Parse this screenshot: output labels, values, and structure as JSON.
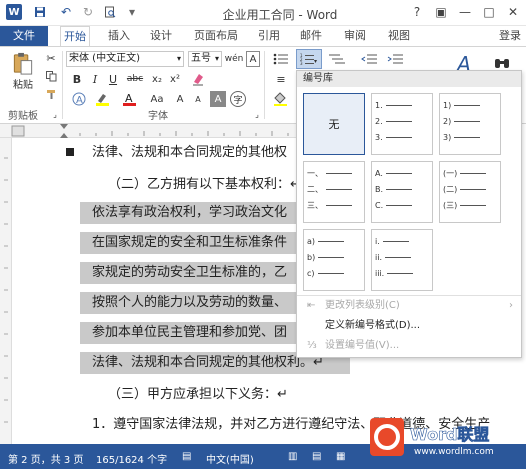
{
  "title_bar": {
    "title": "企业用工合同 - Word"
  },
  "tabs": [
    "文件",
    "开始",
    "插入",
    "设计",
    "页面布局",
    "引用",
    "邮件",
    "审阅",
    "视图"
  ],
  "signin_label": "登录",
  "ribbon": {
    "font_name": "宋体 (中文正文)",
    "font_size": "五号",
    "clipboard_label": "剪贴板",
    "font_group_label": "字体",
    "paste_label": "粘贴"
  },
  "document": {
    "lines": [
      "法律、法规和本合同规定的其他权",
      "（二）乙方拥有以下基本权利：↵",
      "依法享有政治权利，学习政治文化",
      "在国家规定的安全和卫生标准条件",
      "家规定的劳动安全卫生标准的，乙",
      "按照个人的能力以及劳动的数量、",
      "参加本单位民主管理和参加党、团",
      "法律、法规和本合同规定的其他权利。↵",
      "（三）甲方应承担以下义务：↵",
      "1．遵守国家法律法规，并对乙方进行遵纪守法、职业道德、安全生产"
    ]
  },
  "dropdown": {
    "header": "编号库",
    "tiles": [
      {
        "label": "无",
        "rows": []
      },
      {
        "rows": [
          "1.",
          "2.",
          "3."
        ]
      },
      {
        "rows": [
          "1)",
          "2)",
          "3)"
        ]
      },
      {
        "rows": [
          "一、",
          "二、",
          "三、"
        ]
      },
      {
        "rows": [
          "A.",
          "B.",
          "C."
        ]
      },
      {
        "rows": [
          "(一)",
          "(二)",
          "(三)"
        ]
      },
      {
        "rows": [
          "a)",
          "b)",
          "c)"
        ]
      },
      {
        "rows": [
          "i.",
          "ii.",
          "iii."
        ]
      }
    ],
    "menu": [
      {
        "label": "更改列表级别(C)",
        "enabled": false
      },
      {
        "label": "定义新编号格式(D)...",
        "enabled": true
      },
      {
        "label": "设置编号值(V)...",
        "enabled": false
      }
    ]
  },
  "status_bar": {
    "page": "第 2 页，共 3 页",
    "words": "165/1624 个字",
    "language": "中文(中国)"
  },
  "watermark": {
    "text1": "Word联盟",
    "text2": "www.wordlm.com"
  },
  "colors": {
    "accent": "#2b579a",
    "selection": "#c9c9c9"
  }
}
